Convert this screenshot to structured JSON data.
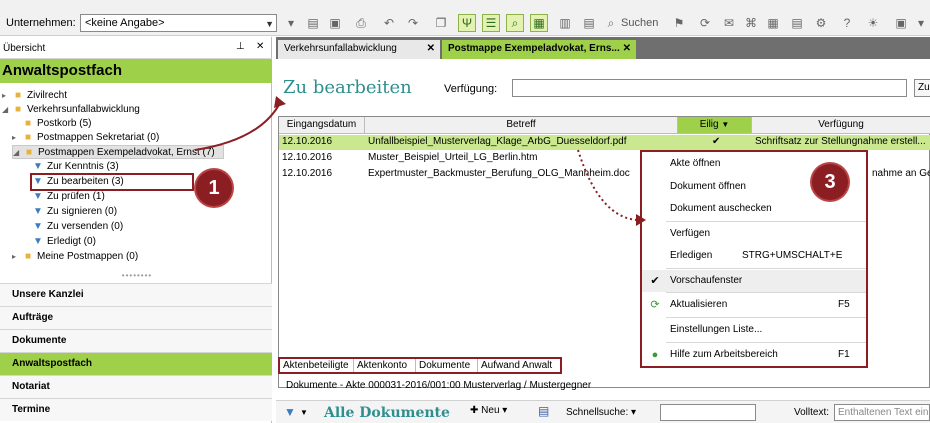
{
  "toolbar": {
    "company_label": "Unternehmen:",
    "company_value": "<keine Angabe>",
    "search_label": "Suchen"
  },
  "left_pane": {
    "header": "Übersicht",
    "title": "Anwaltspostfach",
    "tree": [
      {
        "label": "Zivilrecht",
        "type": "folder"
      },
      {
        "label": "Verkehrsunfallabwicklung",
        "type": "folder"
      },
      {
        "label": "Postkorb (5)",
        "type": "folder"
      },
      {
        "label": "Postmappen Sekretariat (0)",
        "type": "folder"
      },
      {
        "label": "Postmappen Exempeladvokat, Ernst  (7)",
        "type": "folder"
      },
      {
        "label": "Zur Kenntnis (3)",
        "type": "filter"
      },
      {
        "label": "Zu bearbeiten (3)",
        "type": "filter"
      },
      {
        "label": "Zu prüfen (1)",
        "type": "filter"
      },
      {
        "label": "Zu signieren (0)",
        "type": "filter"
      },
      {
        "label": "Zu versenden (0)",
        "type": "filter"
      },
      {
        "label": "Erledigt (0)",
        "type": "filter"
      },
      {
        "label": "Meine Postmappen (0)",
        "type": "folder"
      }
    ],
    "nav": [
      "Unsere Kanzlei",
      "Aufträge",
      "Dokumente",
      "Anwaltspostfach",
      "Notariat",
      "Termine"
    ]
  },
  "tabs": [
    {
      "label": "Verkehrsunfallabwicklung"
    },
    {
      "label": "Postmappe Exempeladvokat, Erns..."
    }
  ],
  "view": {
    "title": "Zu bearbeiten",
    "verfuegung_label": "Verfügung:",
    "zu_button": "Zu"
  },
  "grid": {
    "columns": [
      "Eingangsdatum",
      "Betreff",
      "Eilig",
      "Verfügung"
    ],
    "rows": [
      {
        "date": "12.10.2016",
        "subject": "Unfallbeispiel_Musterverlag_Klage_ArbG_Duesseldorf.pdf",
        "eilig": "✔",
        "verfuegung": "Schriftsatz zur Stellungnahme erstell..."
      },
      {
        "date": "12.10.2016",
        "subject": "Muster_Beispiel_Urteil_LG_Berlin.htm",
        "eilig": "",
        "verfuegung": ""
      },
      {
        "date": "12.10.2016",
        "subject": "Expertmuster_Backmuster_Berufung_OLG_Mannheim.doc",
        "eilig": "",
        "verfuegung": "nahme an Ge..."
      }
    ]
  },
  "context_menu": {
    "items": [
      {
        "label": "Akte öffnen",
        "shortcut": ""
      },
      {
        "label": "Dokument öffnen",
        "shortcut": ""
      },
      {
        "label": "Dokument auschecken",
        "shortcut": ""
      },
      {
        "label": "Verfügen",
        "shortcut": ""
      },
      {
        "label": "Erledigen",
        "shortcut": "STRG+UMSCHALT+E"
      },
      {
        "label": "Vorschaufenster",
        "shortcut": ""
      },
      {
        "label": "Aktualisieren",
        "shortcut": "F5"
      },
      {
        "label": "Einstellungen Liste...",
        "shortcut": ""
      },
      {
        "label": "Hilfe zum Arbeitsbereich",
        "shortcut": "F1"
      }
    ]
  },
  "bottom_tabs": [
    "Aktenbeteiligte",
    "Aktenkonto",
    "Dokumente",
    "Aufwand Anwalt"
  ],
  "breadcrumb": "Dokumente - Akte 000031-2016/001:00 Musterverlag  /  Mustergegner",
  "bottom_bar": {
    "title": "Alle Dokumente",
    "neu": "Neu",
    "schnellsuche": "Schnellsuche:",
    "volltext": "Volltext:",
    "volltext_placeholder": "Enthaltenen Text eing"
  },
  "callouts": [
    "1",
    "3"
  ],
  "colors": {
    "accent_green": "#9ed04a",
    "callout_red": "#8a1e22",
    "title_teal": "#2f8f8f"
  }
}
